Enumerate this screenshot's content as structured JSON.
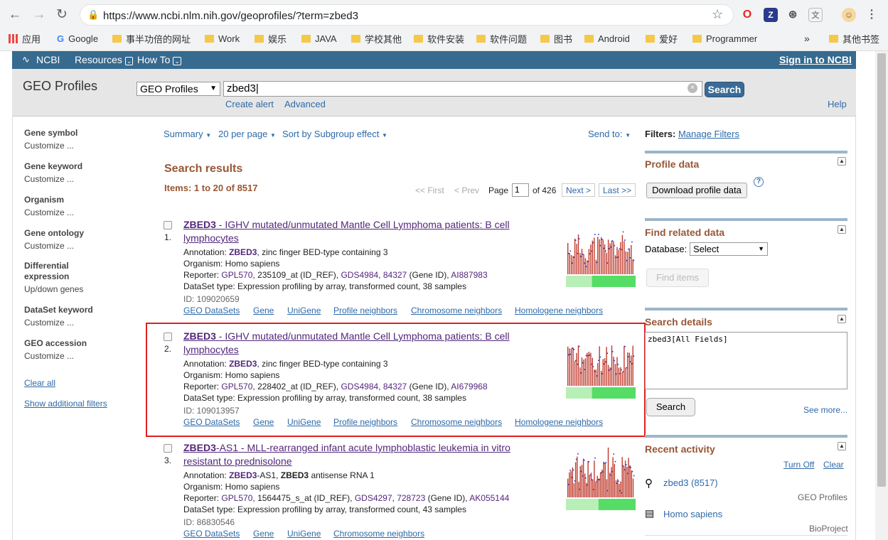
{
  "browser": {
    "url": "https://www.ncbi.nlm.nih.gov/geoprofiles/?term=zbed3",
    "bookmarks": [
      "应用",
      "Google",
      "事半功倍的网址",
      "Work",
      "娱乐",
      "JAVA",
      "学校其他",
      "软件安装",
      "软件问题",
      "图书",
      "Android",
      "爱好",
      "Programmer",
      "其他书签"
    ],
    "more": "»"
  },
  "ncbi": {
    "logo": "NCBI",
    "resources": "Resources",
    "howto": "How To",
    "signin": "Sign in to NCBI"
  },
  "search": {
    "page_title": "GEO Profiles",
    "db": "GEO Profiles",
    "term": "zbed3",
    "button": "Search",
    "create_alert": "Create alert",
    "advanced": "Advanced",
    "help": "Help"
  },
  "facets": [
    {
      "head": "Gene symbol",
      "sub": "Customize ..."
    },
    {
      "head": "Gene keyword",
      "sub": "Customize ..."
    },
    {
      "head": "Organism",
      "sub": "Customize ..."
    },
    {
      "head": "Gene ontology",
      "sub": "Customize ..."
    },
    {
      "head": "Differential",
      "head2": "expression",
      "sub": "Up/down genes"
    },
    {
      "head": "DataSet keyword",
      "sub": "Customize ..."
    },
    {
      "head": "GEO accession",
      "sub": "Customize ..."
    }
  ],
  "left_links": {
    "clear_all": "Clear all",
    "show_filters": "Show additional filters"
  },
  "toolbar": {
    "summary": "Summary",
    "per_page": "20 per page",
    "sort": "Sort by Subgroup effect",
    "send_to": "Send to:"
  },
  "results_head": {
    "title": "Search results",
    "items": "Items: 1 to 20 of 8517"
  },
  "pager": {
    "first": "<< First",
    "prev": "< Prev",
    "page_label": "Page",
    "page": "1",
    "of": "of 426",
    "next": "Next >",
    "last": "Last >>"
  },
  "results": [
    {
      "num": "1.",
      "title_bold": "ZBED3",
      "title_rest": " - IGHV mutated/unmutated Mantle Cell Lymphoma patients: B cell",
      "title_line2": "lymphocytes",
      "annotation_label": "Annotation: ",
      "annotation_gene": "ZBED3",
      "annotation_rest": ", zinc finger BED-type containing 3",
      "organism": "Organism: Homo sapiens",
      "reporter_label": "Reporter: ",
      "platform": "GPL570",
      "reporter_id": ", 235109_at (ID_REF), ",
      "gds": "GDS4984",
      "sep": ", ",
      "gene_id": "84327",
      "gene_id_suffix": " (Gene ID), ",
      "acc": "AI887983",
      "dataset": "DataSet type: Expression profiling by array, transformed count, 38 samples",
      "id": "ID: 109020659",
      "links": [
        "GEO DataSets",
        "Gene",
        "UniGene",
        "Profile neighbors",
        "Chromosome neighbors",
        "Homologene neighbors"
      ]
    },
    {
      "num": "2.",
      "title_bold": "ZBED3",
      "title_rest": " - IGHV mutated/unmutated Mantle Cell Lymphoma patients: B cell",
      "title_line2": "lymphocytes",
      "annotation_label": "Annotation: ",
      "annotation_gene": "ZBED3",
      "annotation_rest": ", zinc finger BED-type containing 3",
      "organism": "Organism: Homo sapiens",
      "reporter_label": "Reporter: ",
      "platform": "GPL570",
      "reporter_id": ", 228402_at (ID_REF), ",
      "gds": "GDS4984",
      "sep": ", ",
      "gene_id": "84327",
      "gene_id_suffix": " (Gene ID), ",
      "acc": "AI679968",
      "dataset": "DataSet type: Expression profiling by array, transformed count, 38 samples",
      "id": "ID: 109013957",
      "links": [
        "GEO DataSets",
        "Gene",
        "UniGene",
        "Profile neighbors",
        "Chromosome neighbors",
        "Homologene neighbors"
      ]
    },
    {
      "num": "3.",
      "title_bold": "ZBED3",
      "title_rest": "-AS1 - MLL-rearranged infant acute lymphoblastic leukemia in vitro",
      "title_line2": "resistant to prednisolone",
      "annotation_label": "Annotation: ",
      "annotation_gene": "ZBED3",
      "annotation_rest": "-AS1, ",
      "annotation_gene2": "ZBED3",
      "annotation_rest2": " antisense RNA 1",
      "organism": "Organism: Homo sapiens",
      "reporter_label": "Reporter: ",
      "platform": "GPL570",
      "reporter_id": ", 1564475_s_at (ID_REF), ",
      "gds": "GDS4297",
      "sep": ", ",
      "gene_id": "728723",
      "gene_id_suffix": " (Gene ID), ",
      "acc": "AK055144",
      "dataset": "DataSet type: Expression profiling by array, transformed count, 43 samples",
      "id": "ID: 86830546",
      "links": [
        "GEO DataSets",
        "Gene",
        "UniGene",
        "Chromosome neighbors"
      ]
    }
  ],
  "right": {
    "filters_label": "Filters: ",
    "manage_filters": "Manage Filters",
    "profile_data": "Profile data",
    "download": "Download profile data",
    "help_icon": "?",
    "find_related": "Find related data",
    "database_label": "Database:",
    "database_value": "Select",
    "find_items": "Find items",
    "search_details": "Search details",
    "details_query": "zbed3[All Fields]",
    "details_search": "Search",
    "see_more": "See more...",
    "recent": "Recent activity",
    "turn_off": "Turn Off",
    "clear": "Clear",
    "recent_items": [
      {
        "text": "zbed3 (8517)",
        "db": "GEO Profiles"
      },
      {
        "text": "Homo sapiens",
        "db": "BioProject"
      }
    ]
  },
  "colors": {
    "ncbi_bar": "#366a8f",
    "highlight_box": "#e02020",
    "section_head": "#985735",
    "link": "#2e6aa8",
    "visited": "#53277b"
  }
}
